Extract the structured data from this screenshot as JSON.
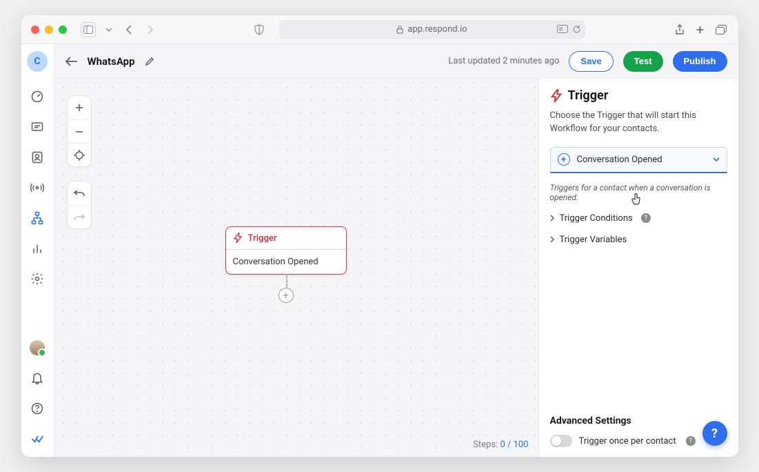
{
  "chrome": {
    "url": "app.respond.io"
  },
  "topbar": {
    "workflow_name": "WhatsApp",
    "last_updated": "Last updated 2 minutes ago",
    "save": "Save",
    "test": "Test",
    "publish": "Publish"
  },
  "rail": {
    "avatar_initial": "C"
  },
  "canvas": {
    "node": {
      "title": "Trigger",
      "subtitle": "Conversation Opened"
    },
    "steps_label": "Steps:",
    "steps_count": "0 / 100"
  },
  "panel": {
    "title": "Trigger",
    "description": "Choose the Trigger that will start this Workflow for your contacts.",
    "select_label": "Conversation Opened",
    "help_text": "Triggers for a contact when a conversation is opened.",
    "conditions_label": "Trigger Conditions",
    "variables_label": "Trigger Variables",
    "advanced_header": "Advanced Settings",
    "toggle_label": "Trigger once per contact"
  }
}
